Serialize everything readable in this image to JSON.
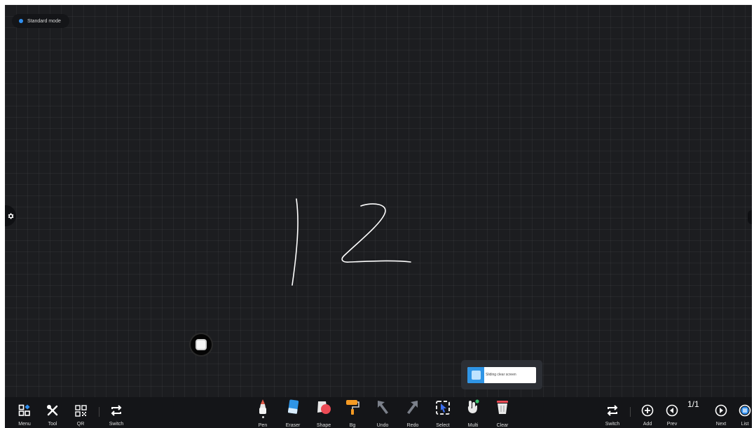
{
  "mode_badge": {
    "label": "Standard mode",
    "dot_color": "#2f8ff0"
  },
  "canvas": {
    "background": "#1c1d20",
    "ink_color": "#ffffff"
  },
  "clear_popup": {
    "label": "Sliding clear screen"
  },
  "toolbar": {
    "left": [
      {
        "label": "Menu",
        "icon": "menu-grid-icon"
      },
      {
        "label": "Tool",
        "icon": "tools-icon"
      },
      {
        "label": "QR",
        "icon": "qr-code-icon"
      },
      {
        "label": "Switch",
        "icon": "switch-icon"
      }
    ],
    "tools": [
      {
        "label": "Pen",
        "icon": "pen-icon"
      },
      {
        "label": "Eraser",
        "icon": "eraser-icon"
      },
      {
        "label": "Shape",
        "icon": "shape-icon"
      },
      {
        "label": "Bg",
        "icon": "paint-roller-icon"
      },
      {
        "label": "Undo",
        "icon": "undo-arrow-icon"
      },
      {
        "label": "Redo",
        "icon": "redo-arrow-icon"
      },
      {
        "label": "Select",
        "icon": "select-icon"
      },
      {
        "label": "Multi",
        "icon": "multi-touch-icon"
      },
      {
        "label": "Clear",
        "icon": "trash-icon"
      }
    ],
    "right": [
      {
        "label": "Switch",
        "icon": "switch-icon"
      },
      {
        "label": "Add",
        "icon": "add-page-icon"
      },
      {
        "label": "Prev",
        "icon": "prev-page-icon"
      },
      {
        "label": "Next",
        "icon": "next-page-icon"
      },
      {
        "label": "List",
        "icon": "page-list-icon"
      }
    ],
    "page_indicator": "1/1"
  }
}
